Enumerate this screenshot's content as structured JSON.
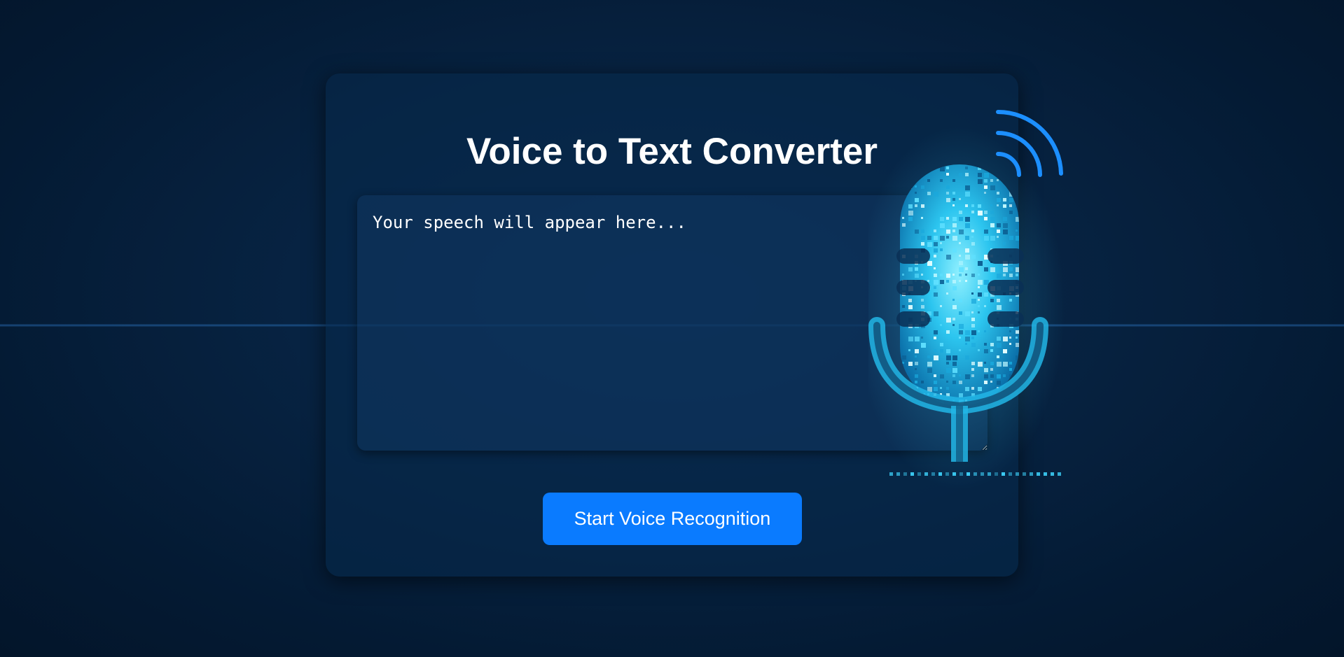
{
  "page": {
    "title": "Voice to Text Converter"
  },
  "speech_box": {
    "placeholder": "Your speech will appear here...",
    "value": ""
  },
  "controls": {
    "start_label": "Start Voice Recognition"
  },
  "icons": {
    "microphone": "microphone-icon",
    "signal": "wifi-signal-icon",
    "resize": "resize-handle-icon"
  },
  "colors": {
    "background": "#041a33",
    "card": "#06284b",
    "accent": "#0a7bff",
    "wave": "#1a5a9e",
    "mic_glow": "#3fd6ff",
    "text": "#ffffff"
  }
}
